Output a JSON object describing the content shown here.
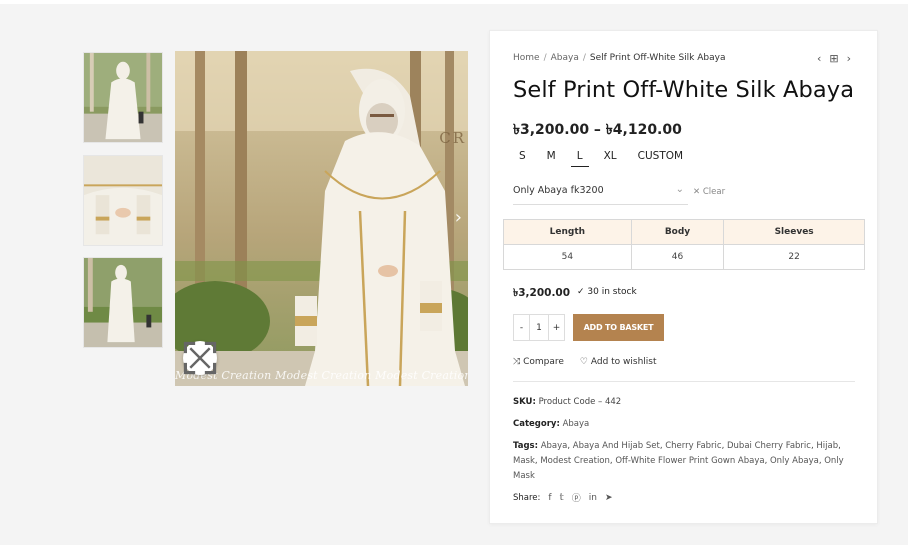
{
  "breadcrumb": {
    "home": "Home",
    "sep": "/",
    "category": "Abaya",
    "current": "Self Print Off-White Silk Abaya"
  },
  "nav": {
    "prev": "‹",
    "grid": "⊞",
    "next": "›"
  },
  "product": {
    "title": "Self Print Off-White Silk Abaya",
    "price_range": "৳3,200.00 – ৳4,120.00"
  },
  "sizes": [
    "S",
    "M",
    "L",
    "XL",
    "CUSTOM"
  ],
  "selected_size": "L",
  "variation_select": {
    "value": "Only Abaya fk3200"
  },
  "clear_label": "Clear",
  "spec_table": {
    "headers": [
      "Length",
      "Body",
      "Sleeves"
    ],
    "values": [
      "54",
      "46",
      "22"
    ]
  },
  "variation_price": "৳3,200.00",
  "stock": "30 in stock",
  "quantity": "1",
  "add_to_basket": "ADD TO BASKET",
  "compare": "Compare",
  "wishlist": "Add to wishlist",
  "sku": {
    "label": "SKU:",
    "value": "Product Code – 442"
  },
  "category": {
    "label": "Category:",
    "value": "Abaya"
  },
  "tags": {
    "label": "Tags:",
    "items": [
      "Abaya",
      "Abaya And Hijab Set",
      "Cherry Fabric",
      "Dubai Cherry Fabric",
      "Hijab",
      "Mask",
      "Modest Creation",
      "Off-White Flower Print Gown Abaya",
      "Only Abaya",
      "Only Mask"
    ]
  },
  "share_label": "Share:",
  "image": {
    "watermark": "Modest Creation Modest Creation Modest Creation Modest Creation",
    "brand_mark": "CR"
  },
  "colors": {
    "accent": "#b4834f",
    "table_header": "#fdf3e8"
  },
  "icons": [
    "expand-icon",
    "check-icon",
    "compare-icon",
    "heart-icon",
    "facebook-icon",
    "twitter-icon",
    "pinterest-icon",
    "linkedin-icon",
    "telegram-icon"
  ]
}
